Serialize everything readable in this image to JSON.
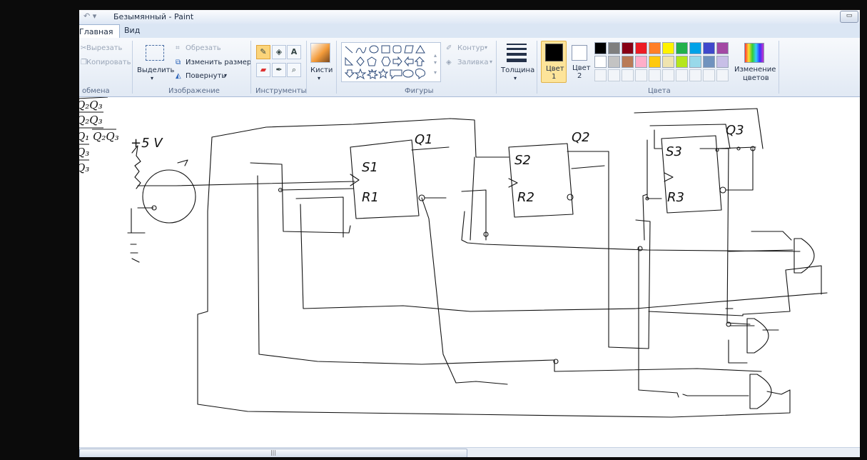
{
  "window": {
    "title": "Безымянный - Paint"
  },
  "tabs": {
    "home": "Главная",
    "view": "Вид"
  },
  "ribbon": {
    "clipboard": {
      "cut": "Вырезать",
      "copy": "Копировать",
      "group": "обмена"
    },
    "image": {
      "select": "Выделить",
      "crop": "Обрезать",
      "resize": "Изменить размер",
      "rotate": "Повернуть",
      "group": "Изображение"
    },
    "tools": {
      "group": "Инструменты"
    },
    "brushes": {
      "label": "Кисти"
    },
    "shapes": {
      "outline": "Контур",
      "fill": "Заливка",
      "group": "Фигуры"
    },
    "size": {
      "label": "Толщина"
    },
    "colors": {
      "color1_label": "Цвет",
      "color1_num": "1",
      "color2_label": "Цвет",
      "color2_num": "2",
      "edit_line1": "Изменение",
      "edit_line2": "цветов",
      "group": "Цвета"
    },
    "palette": [
      "#000000",
      "#7f7f7f",
      "#880015",
      "#ed1c24",
      "#ff7f27",
      "#fff200",
      "#22b14c",
      "#00a2e8",
      "#3f48cc",
      "#a349a4",
      "#ffffff",
      "#c3c3c3",
      "#b97a57",
      "#ffaec9",
      "#ffc90e",
      "#efe4b0",
      "#b5e61d",
      "#99d9ea",
      "#7092be",
      "#c8bfe7"
    ]
  },
  "drawing": {
    "voltage": "+5 V",
    "q1": "Q1",
    "q2": "Q2",
    "q3": "Q3",
    "s1": "S1",
    "r1": "R1",
    "s2": "S2",
    "r2": "R2",
    "s3": "S3",
    "r3": "R3",
    "left_edge_lines": [
      "Q₂Q₃",
      "Q₂Q₃",
      "Q₁ Q₂Q₃",
      "Q₃",
      "Q₃"
    ]
  },
  "scrollbar": {
    "grip": "|||"
  }
}
